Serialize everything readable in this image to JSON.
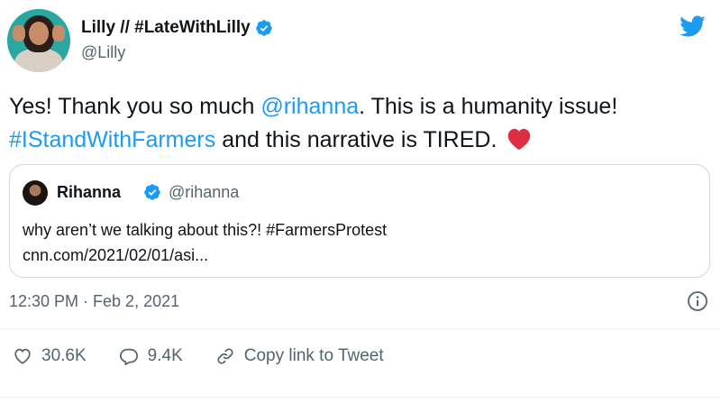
{
  "author": {
    "display_name": "Lilly // #LateWithLilly",
    "handle": "@Lilly",
    "verified_icon": "verified-badge-icon",
    "avatar": "avatar"
  },
  "brand": {
    "icon": "twitter-bird-icon",
    "color": "#1d9bf0"
  },
  "tweet": {
    "part1": "Yes! Thank you so much ",
    "mention": "@rihanna",
    "part2": ". This is a humanity issue!",
    "hashtag": "#IStandWithFarmers",
    "part3": " and this narrative is TIRED.",
    "emoji_icon": "red-heart-icon"
  },
  "quoted_tweet": {
    "display_name": "Rihanna",
    "handle": "@rihanna",
    "line1": "why aren’t we talking about this?! #FarmersProtest",
    "line2": "cnn.com/2021/02/01/asi..."
  },
  "timestamp": "12:30 PM · Feb 2, 2021",
  "actions": {
    "likes": "30.6K",
    "replies": "9.4K",
    "copy_link": "Copy link to Tweet"
  },
  "colors": {
    "link": "#1d9bf0",
    "secondary_text": "#536471",
    "border": "#cfd9de",
    "heart": "#e0245e"
  }
}
